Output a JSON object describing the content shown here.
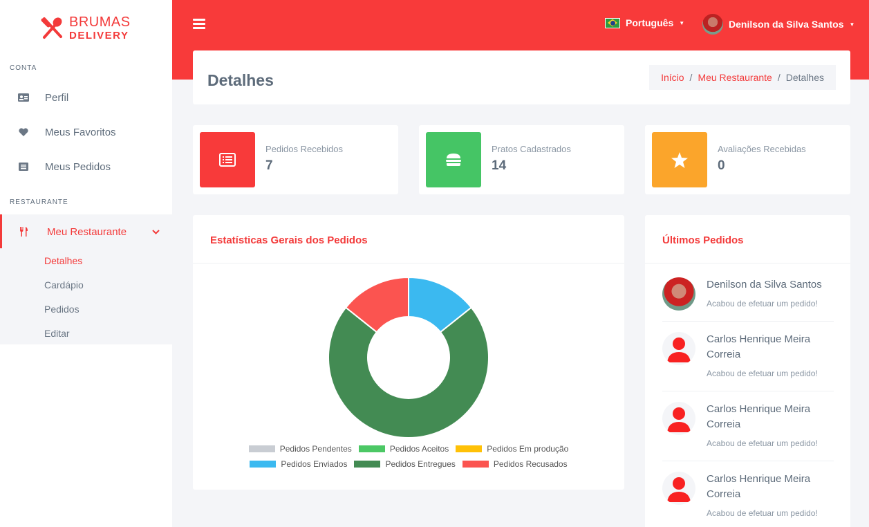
{
  "brand": {
    "line1": "BRUMAS",
    "line2": "DELIVERY"
  },
  "sidebar": {
    "section_account": "CONTA",
    "section_restaurant": "RESTAURANTE",
    "items": [
      {
        "label": "Perfil",
        "icon": "id-card-icon"
      },
      {
        "label": "Meus Favoritos",
        "icon": "heart-icon"
      },
      {
        "label": "Meus Pedidos",
        "icon": "list-icon"
      }
    ],
    "restaurant_item": {
      "label": "Meu Restaurante",
      "icon": "utensils-icon"
    },
    "submenu": [
      "Detalhes",
      "Cardápio",
      "Pedidos",
      "Editar"
    ]
  },
  "header": {
    "language": "Português",
    "user_name": "Denilson da Silva Santos"
  },
  "page": {
    "title": "Detalhes",
    "breadcrumb": [
      "Início",
      "Meu Restaurante",
      "Detalhes"
    ]
  },
  "stats": [
    {
      "label": "Pedidos Recebidos",
      "value": "7",
      "color": "#f83a3a",
      "icon": "list-icon"
    },
    {
      "label": "Pratos Cadastrados",
      "value": "14",
      "color": "#45c565",
      "icon": "burger-icon"
    },
    {
      "label": "Avaliações Recebidas",
      "value": "0",
      "color": "#fba52b",
      "icon": "star-icon"
    }
  ],
  "chart_card": {
    "title": "Estatísticas Gerais dos Pedidos"
  },
  "chart_data": {
    "type": "pie",
    "donut": true,
    "categories": [
      "Pedidos Pendentes",
      "Pedidos Aceitos",
      "Pedidos Em produção",
      "Pedidos Enviados",
      "Pedidos Entregues",
      "Pedidos Recusados"
    ],
    "values": [
      0,
      0,
      0,
      1,
      5,
      1
    ],
    "colors": [
      "#c9cdd3",
      "#4cc865",
      "#ffc107",
      "#3bb9f0",
      "#438b53",
      "#fb5450"
    ],
    "legend": "bottom"
  },
  "orders_card": {
    "title": "Últimos Pedidos",
    "orders": [
      {
        "name": "Denilson da Silva Santos",
        "message": "Acabou de efetuar um pedido!",
        "avatar": "photo"
      },
      {
        "name": "Carlos Henrique Meira Correia",
        "message": "Acabou de efetuar um pedido!",
        "avatar": "user-icon"
      },
      {
        "name": "Carlos Henrique Meira Correia",
        "message": "Acabou de efetuar um pedido!",
        "avatar": "user-icon"
      },
      {
        "name": "Carlos Henrique Meira Correia",
        "message": "Acabou de efetuar um pedido!",
        "avatar": "user-icon"
      }
    ]
  }
}
